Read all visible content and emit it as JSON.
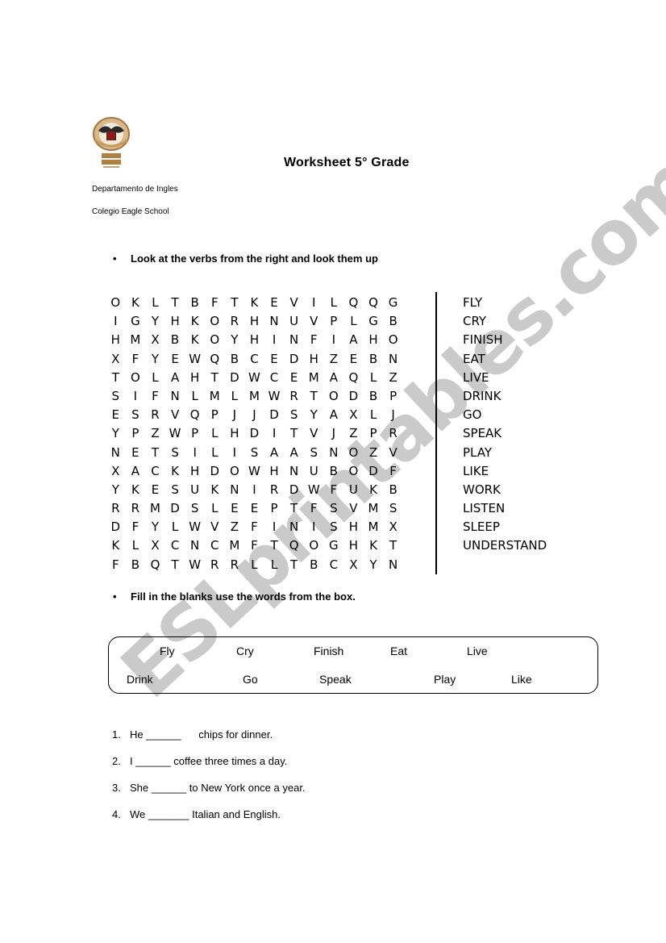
{
  "header": {
    "logo_alt": "Eagle School crest",
    "title": "Worksheet 5° Grade",
    "department": "Departamento de Ingles",
    "school": "Colegio Eagle School"
  },
  "section1": {
    "bullet": "•",
    "instruction": "Look at the verbs from the right and look them up"
  },
  "wordsearch": {
    "rows": [
      [
        "O",
        "K",
        "L",
        "T",
        "B",
        "F",
        "T",
        "K",
        "E",
        "V",
        "I",
        "L",
        "Q",
        "Q",
        "G"
      ],
      [
        "I",
        "G",
        "Y",
        "H",
        "K",
        "O",
        "R",
        "H",
        "N",
        "U",
        "V",
        "P",
        "L",
        "G",
        "B"
      ],
      [
        "H",
        "M",
        "X",
        "B",
        "K",
        "O",
        "Y",
        "H",
        "I",
        "N",
        "F",
        "I",
        "A",
        "H",
        "O"
      ],
      [
        "X",
        "F",
        "Y",
        "E",
        "W",
        "Q",
        "B",
        "C",
        "E",
        "D",
        "H",
        "Z",
        "E",
        "B",
        "N"
      ],
      [
        "T",
        "O",
        "L",
        "A",
        "H",
        "T",
        "D",
        "W",
        "C",
        "E",
        "M",
        "A",
        "Q",
        "L",
        "Z"
      ],
      [
        "S",
        "I",
        "F",
        "N",
        "L",
        "M",
        "L",
        "M",
        "W",
        "R",
        "T",
        "O",
        "D",
        "B",
        "P"
      ],
      [
        "E",
        "S",
        "R",
        "V",
        "Q",
        "P",
        "J",
        "J",
        "D",
        "S",
        "Y",
        "A",
        "X",
        "L",
        "J"
      ],
      [
        "Y",
        "P",
        "Z",
        "W",
        "P",
        "L",
        "H",
        "D",
        "I",
        "T",
        "V",
        "J",
        "Z",
        "P",
        "R"
      ],
      [
        "N",
        "E",
        "T",
        "S",
        "I",
        "L",
        "I",
        "S",
        "A",
        "A",
        "S",
        "N",
        "O",
        "Z",
        "V"
      ],
      [
        "X",
        "A",
        "C",
        "K",
        "H",
        "D",
        "O",
        "W",
        "H",
        "N",
        "U",
        "B",
        "O",
        "D",
        "F"
      ],
      [
        "Y",
        "K",
        "E",
        "S",
        "U",
        "K",
        "N",
        "I",
        "R",
        "D",
        "W",
        "F",
        "U",
        "K",
        "B"
      ],
      [
        "R",
        "R",
        "M",
        "D",
        "S",
        "L",
        "E",
        "E",
        "P",
        "T",
        "F",
        "S",
        "V",
        "M",
        "S"
      ],
      [
        "D",
        "F",
        "Y",
        "L",
        "W",
        "V",
        "Z",
        "F",
        "I",
        "N",
        "I",
        "S",
        "H",
        "M",
        "X"
      ],
      [
        "K",
        "L",
        "X",
        "C",
        "N",
        "C",
        "M",
        "F",
        "T",
        "Q",
        "O",
        "G",
        "H",
        "K",
        "T"
      ],
      [
        "F",
        "B",
        "Q",
        "T",
        "W",
        "R",
        "R",
        "L",
        "L",
        "T",
        "B",
        "C",
        "X",
        "Y",
        "N"
      ]
    ],
    "verbs": [
      "FLY",
      "CRY",
      "FINISH",
      "EAT",
      "LIVE",
      "DRINK",
      "GO",
      "SPEAK",
      "PLAY",
      "LIKE",
      "WORK",
      "LISTEN",
      "SLEEP",
      "UNDERSTAND"
    ]
  },
  "section2": {
    "bullet": "•",
    "instruction": "Fill in the blanks use the words from the box."
  },
  "word_box": {
    "row1": [
      "Fly",
      "Cry",
      "Finish",
      "Eat",
      "Live"
    ],
    "row2": [
      "Drink",
      "Go",
      "Speak",
      "Play",
      "Like"
    ]
  },
  "questions": [
    {
      "num": "1.",
      "text": "He ______      chips for dinner."
    },
    {
      "num": "2.",
      "text": "I ______ coffee three times a day."
    },
    {
      "num": "3.",
      "text": "She ______ to New York once a year."
    },
    {
      "num": "4.",
      "text": "We _______ Italian and English."
    }
  ],
  "watermark": "ESLprintables.com"
}
